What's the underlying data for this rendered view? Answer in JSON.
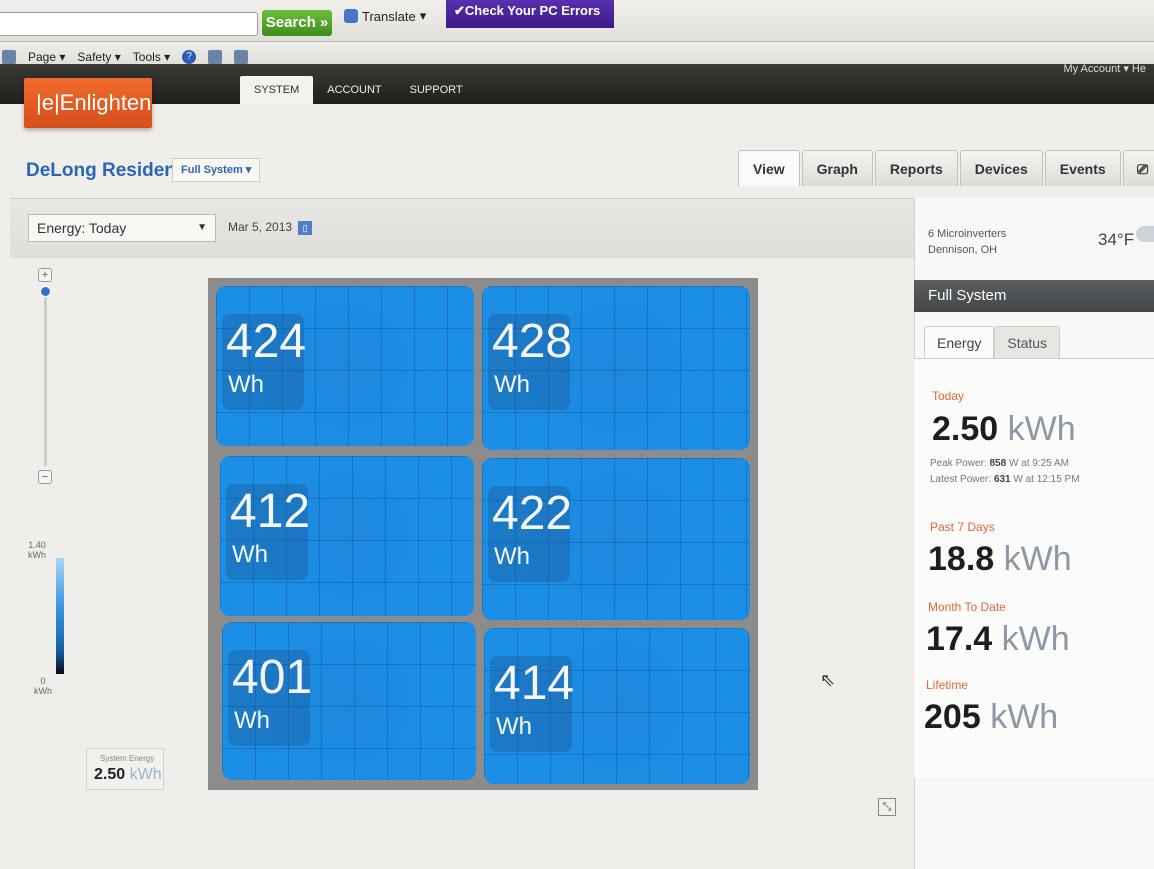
{
  "browser": {
    "search_label": "Search",
    "translate_label": "Translate",
    "check_label": "✔Check Your PC Errors",
    "toolbar": [
      "Page",
      "Safety",
      "Tools"
    ],
    "myaccount": "My Account ▾  He"
  },
  "site": {
    "logo": "|e|Enlighten",
    "top_tabs": [
      {
        "label": "SYSTEM",
        "active": true
      },
      {
        "label": "ACCOUNT",
        "active": false
      },
      {
        "label": "SUPPORT",
        "active": false
      }
    ],
    "system_name": "DeLong Residence",
    "system_select": "Full System ▾",
    "view_tabs": [
      "View",
      "Graph",
      "Reports",
      "Devices",
      "Events"
    ]
  },
  "controls": {
    "energy_select": "Energy: Today",
    "date": "Mar 5, 2013"
  },
  "legend": {
    "top_value": "1.40",
    "top_unit": "kWh",
    "bottom_value": "0",
    "bottom_unit": "kWh"
  },
  "system_energy": {
    "label": "System Energy",
    "value": "2.50",
    "unit": "kWh"
  },
  "panels": [
    {
      "value": "424",
      "unit": "Wh"
    },
    {
      "value": "428",
      "unit": "Wh"
    },
    {
      "value": "412",
      "unit": "Wh"
    },
    {
      "value": "422",
      "unit": "Wh"
    },
    {
      "value": "401",
      "unit": "Wh"
    },
    {
      "value": "414",
      "unit": "Wh"
    }
  ],
  "sidebar": {
    "microinverters": "6 Microinverters",
    "location": "Dennison, OH",
    "temperature": "34°F",
    "section_title": "Full System",
    "tabs": [
      "Energy",
      "Status"
    ],
    "today_label": "Today",
    "today_value": "2.50",
    "today_unit": "kWh",
    "peak_label": "Peak Power:",
    "peak_value": "858",
    "peak_rest": "W at 9:25 AM",
    "latest_label": "Latest Power:",
    "latest_value": "631",
    "latest_rest": "W at 12:15 PM",
    "past7_label": "Past 7 Days",
    "past7_value": "18.8",
    "past7_unit": "kWh",
    "month_label": "Month To Date",
    "month_value": "17.4",
    "month_unit": "kWh",
    "lifetime_label": "Lifetime",
    "lifetime_value": "205",
    "lifetime_unit": "kWh"
  }
}
